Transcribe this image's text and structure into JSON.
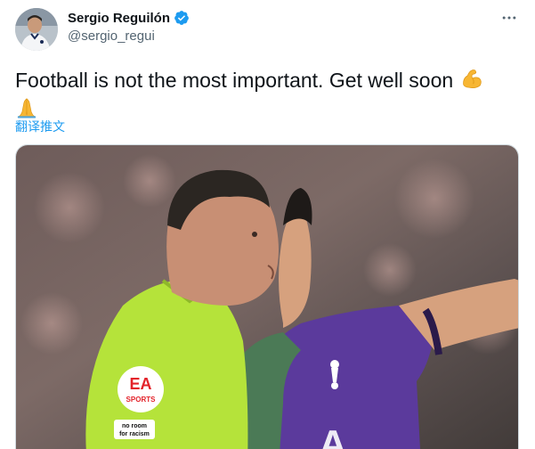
{
  "author": {
    "display_name": "Sergio Reguilón",
    "handle": "@sergio_regui",
    "verified": true
  },
  "menu": {
    "more_icon": "more-horizontal-icon"
  },
  "tweet": {
    "text": "Football is not the most important. Get well soon",
    "emojis": [
      "flexed-biceps",
      "folded-hands"
    ]
  },
  "translate_label": "翻译推文",
  "media": {
    "ea_logo_text": "EA",
    "ea_sports_text": "SPORTS",
    "no_room_text_1": "no room",
    "no_room_text_2": "for racism"
  },
  "colors": {
    "link": "#1d9bf0",
    "verified": "#1d9bf0",
    "handle": "#536471",
    "referee_shirt": "#b5e33a",
    "spurs_purple": "#5b3a9c"
  }
}
